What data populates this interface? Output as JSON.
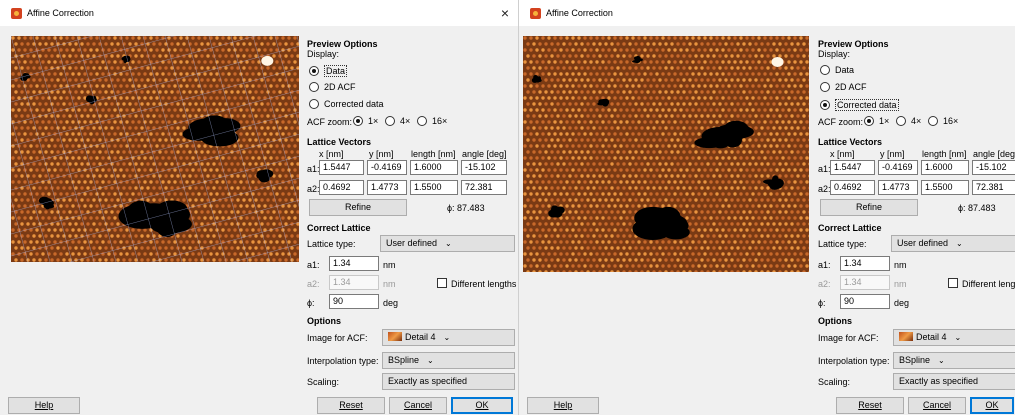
{
  "window_title": "Affine Correction",
  "close_glyph": "×",
  "preview_options": {
    "title": "Preview Options",
    "display_label": "Display:",
    "display_options": [
      "Data",
      "2D ACF",
      "Corrected data"
    ],
    "acf_zoom_label": "ACF zoom:",
    "acf_zoom_options": [
      "1×",
      "4×",
      "16×"
    ],
    "acf_zoom_selected": "1×"
  },
  "lattice_vectors": {
    "title": "Lattice Vectors",
    "headers": [
      "x [nm]",
      "y [nm]",
      "length [nm]",
      "angle [deg]"
    ],
    "row_labels": [
      "a1:",
      "a2:"
    ],
    "rows": [
      [
        "1.5447",
        "-0.4169",
        "1.6000",
        "-15.102"
      ],
      [
        "0.4692",
        "1.4773",
        "1.5500",
        "72.381"
      ]
    ],
    "refine_label": "Refine",
    "phi_readout": "ϕ: 87.483"
  },
  "correct_lattice": {
    "title": "Correct Lattice",
    "lattice_type_label": "Lattice type:",
    "lattice_type_value": "User defined",
    "a1_label": "a1:",
    "a1_value": "1.34",
    "a1_unit": "nm",
    "a2_label": "a2:",
    "a2_value": "1.34",
    "a2_unit": "nm",
    "different_lengths_label": "Different lengths",
    "phi_label": "ϕ:",
    "phi_value": "90",
    "phi_unit": "deg"
  },
  "options": {
    "title": "Options",
    "image_for_acf_label": "Image for ACF:",
    "image_for_acf_value": "Detail 4",
    "interpolation_label": "Interpolation type:",
    "interpolation_value": "BSpline",
    "scaling_label": "Scaling:",
    "scaling_value": "Exactly as specified"
  },
  "buttons": {
    "help": "Help",
    "reset": "Reset",
    "cancel": "Cancel",
    "ok": "OK"
  },
  "windows": [
    {
      "selected_display": "Data"
    },
    {
      "selected_display": "Corrected data"
    }
  ],
  "colors": {
    "surface_dark": "#7a3a14",
    "surface_light": "#e9943f",
    "hole": "#000000",
    "accent": "#0078d7"
  }
}
